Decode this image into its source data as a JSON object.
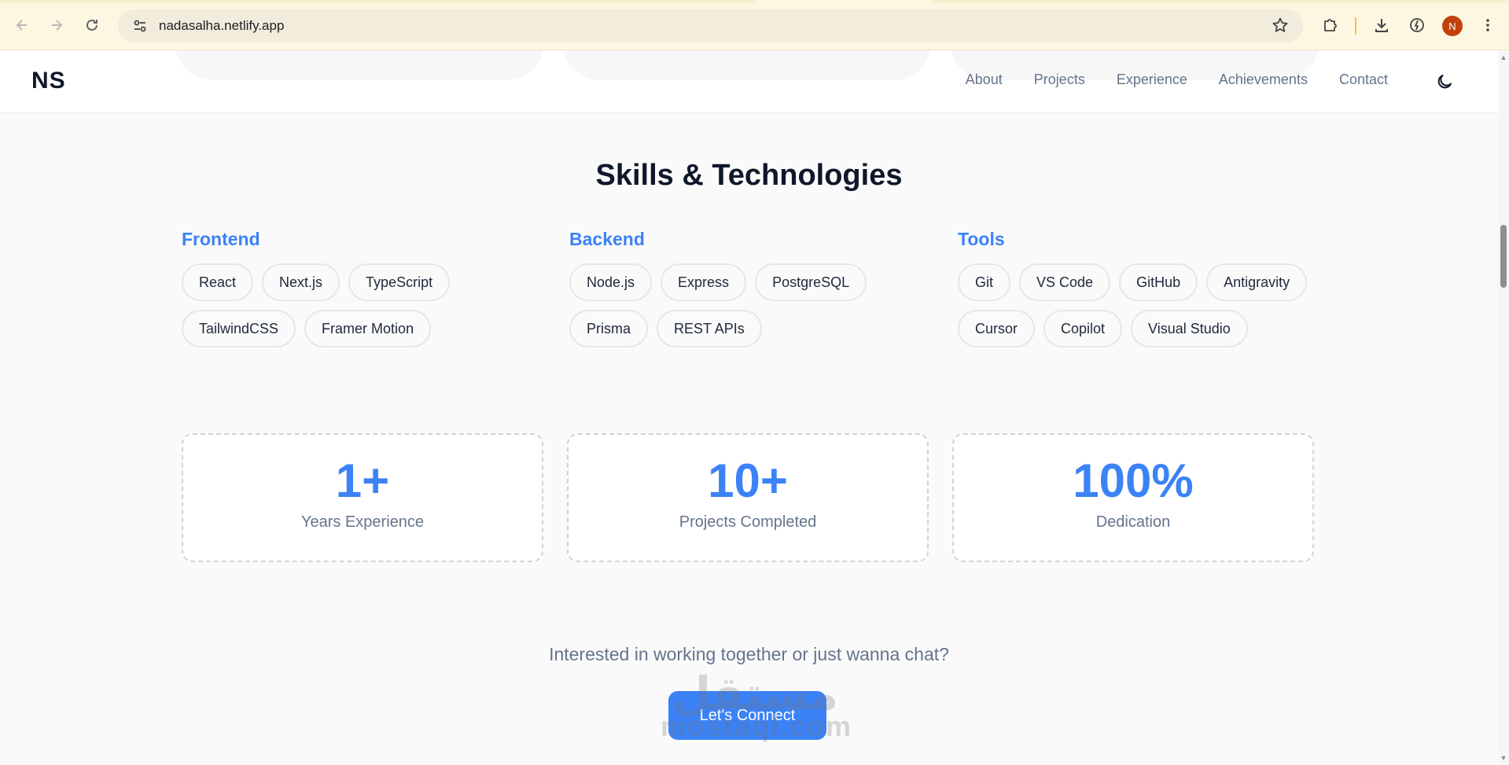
{
  "browser": {
    "url": "nadasalha.netlify.app",
    "profile_initial": "N",
    "icons": {
      "back": "arrow-left-icon",
      "forward": "arrow-right-icon",
      "reload": "reload-icon",
      "site_info": "tune-icon",
      "bookmark": "star-icon",
      "extensions": "puzzle-icon",
      "downloads": "download-icon",
      "performance": "speed-icon",
      "menu": "kebab-menu-icon"
    }
  },
  "header": {
    "logo": "NS",
    "nav": [
      "About",
      "Projects",
      "Experience",
      "Achievements",
      "Contact"
    ],
    "theme_toggle_icon": "moon-icon"
  },
  "skills": {
    "title": "Skills & Technologies",
    "columns": [
      {
        "heading": "Frontend",
        "items": [
          "React",
          "Next.js",
          "TypeScript",
          "TailwindCSS",
          "Framer Motion"
        ]
      },
      {
        "heading": "Backend",
        "items": [
          "Node.js",
          "Express",
          "PostgreSQL",
          "Prisma",
          "REST APIs"
        ]
      },
      {
        "heading": "Tools",
        "items": [
          "Git",
          "VS Code",
          "GitHub",
          "Antigravity",
          "Cursor",
          "Copilot",
          "Visual Studio"
        ]
      }
    ]
  },
  "stats": [
    {
      "value": "1+",
      "label": "Years Experience"
    },
    {
      "value": "10+",
      "label": "Projects Completed"
    },
    {
      "value": "100%",
      "label": "Dedication"
    }
  ],
  "cta": {
    "text": "Interested in working together or just wanna chat?",
    "button": "Let's Connect"
  },
  "watermark": {
    "arabic": "مستقل",
    "latin": "mostaql.com"
  },
  "colors": {
    "accent": "#3b82f6",
    "heading": "#0f172a",
    "muted": "#64748b"
  }
}
